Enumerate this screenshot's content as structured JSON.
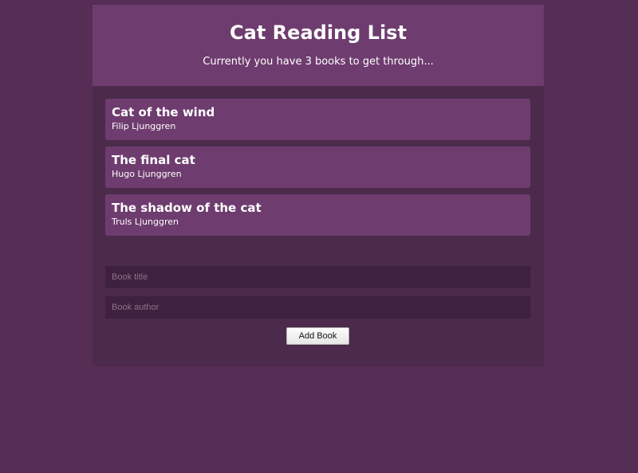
{
  "header": {
    "title": "Cat Reading List",
    "subtitle": "Currently you have 3 books to get through..."
  },
  "books": [
    {
      "title": "Cat of the wind",
      "author": "Filip Ljunggren"
    },
    {
      "title": "The final cat",
      "author": "Hugo Ljunggren"
    },
    {
      "title": "The shadow of the cat",
      "author": "Truls Ljunggren"
    }
  ],
  "form": {
    "title_placeholder": "Book title",
    "author_placeholder": "Book author",
    "submit_label": "Add Book"
  },
  "colors": {
    "page_background": "#552d55",
    "panel_background": "#4c2a4c",
    "accent": "#6e3c6e",
    "input_background": "#3e213e"
  }
}
